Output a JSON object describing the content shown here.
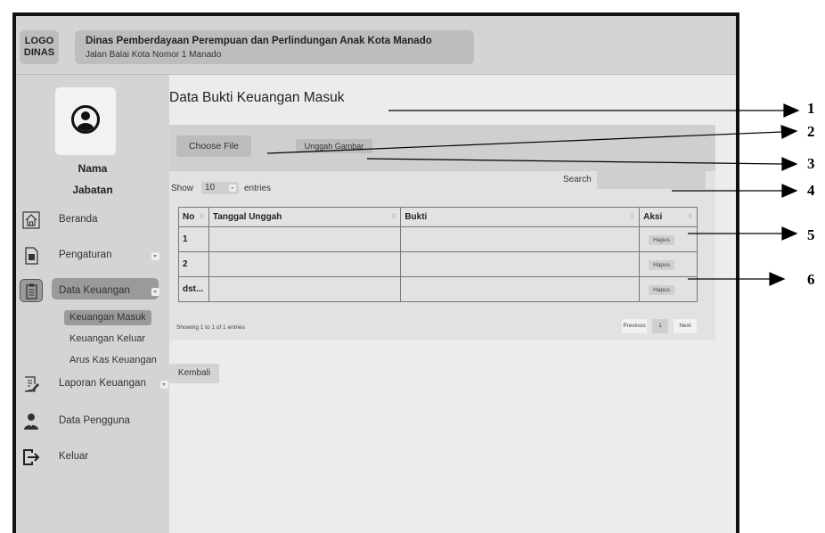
{
  "header": {
    "logo_text": "LOGO\nDINAS",
    "org_title": "Dinas Pemberdayaan Perempuan dan Perlindungan Anak Kota Manado",
    "org_address": "Jalan Balai Kota Nomor 1 Manado"
  },
  "profile": {
    "name": "Nama",
    "role": "Jabatan"
  },
  "sidebar": {
    "items": [
      {
        "label": "Beranda",
        "icon": "home-icon"
      },
      {
        "label": "Pengaturan",
        "icon": "document-icon"
      },
      {
        "label": "Data Keuangan",
        "icon": "clipboard-icon"
      },
      {
        "label": "Laporan Keuangan",
        "icon": "edit-report-icon"
      },
      {
        "label": "Data Pengguna",
        "icon": "user-icon"
      },
      {
        "label": "Keluar",
        "icon": "logout-icon"
      }
    ],
    "sub_items": [
      "Keuangan Masuk",
      "Keuangan Keluar",
      "Arus Kas Keuangan"
    ]
  },
  "main": {
    "title": "Data Bukti Keuangan Masuk",
    "choose_file": "Choose File",
    "upload": "Unggah Gambar",
    "show_label": "Show",
    "show_value": "10",
    "entries_label": "entries",
    "search_label": "Search",
    "search_value": "",
    "table": {
      "headers": [
        "No",
        "Tanggal Unggah",
        "Bukti",
        "Aksi"
      ],
      "rows": [
        {
          "no": "1",
          "tanggal": "",
          "bukti": "",
          "aksi": "Hapus"
        },
        {
          "no": "2",
          "tanggal": "",
          "bukti": "",
          "aksi": "Hapus"
        },
        {
          "no": "dst...",
          "tanggal": "",
          "bukti": "",
          "aksi": "Hapus"
        }
      ]
    },
    "info": "Showing 1 to 1 of 1 entries",
    "pagination": {
      "previous": "Previous",
      "current": "1",
      "next": "Next"
    },
    "back": "Kembali"
  },
  "annotations": [
    "1",
    "2",
    "3",
    "4",
    "5",
    "6"
  ]
}
